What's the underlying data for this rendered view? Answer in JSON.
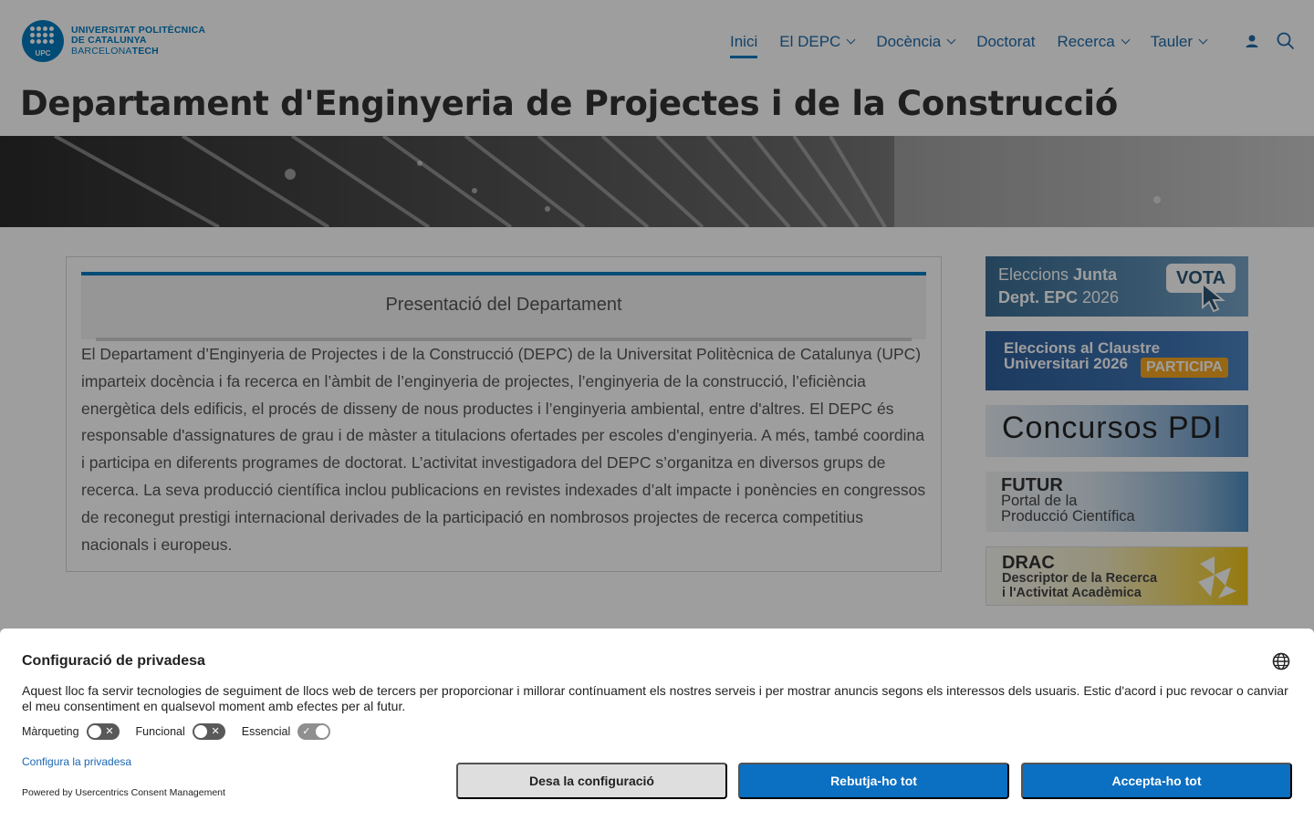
{
  "logo": {
    "line1": "UNIVERSITAT POLITÈCNICA",
    "line2": "DE CATALUNYA",
    "line3a": "BARCELONA",
    "line3b": "TECH",
    "badge": "UPC"
  },
  "nav": {
    "items": [
      {
        "label": "Inici",
        "active": true,
        "dropdown": false
      },
      {
        "label": "El DEPC",
        "active": false,
        "dropdown": true
      },
      {
        "label": "Docència",
        "active": false,
        "dropdown": true
      },
      {
        "label": "Doctorat",
        "active": false,
        "dropdown": false
      },
      {
        "label": "Recerca",
        "active": false,
        "dropdown": true
      },
      {
        "label": "Tauler",
        "active": false,
        "dropdown": true
      }
    ],
    "icons": [
      "user-icon",
      "search-icon"
    ]
  },
  "page_title": {
    "regular": "Departament d'Enginyeria de ",
    "bold": "Projectes i de la Construcció"
  },
  "presentation": {
    "title": "Presentació del Departament",
    "body": "El Departament d’Enginyeria de Projectes i de la Construcció (DEPC) de la Universitat Politècnica de Catalunya (UPC) imparteix docència i fa recerca en l’àmbit de l’enginyeria de projectes, l’enginyeria de la construcció, l’eficiència energètica dels edificis, el procés de disseny de nous productes i l’enginyeria ambiental, entre d'altres. El DEPC és responsable d'assignatures de grau i de màster a titulacions ofertades per escoles d'enginyeria. A més, també coordina i participa en diferents programes de doctorat. L’activitat investigadora del DEPC s’organitza en diversos grups de recerca. La seva producció científica inclou publicacions en revistes indexades d’alt impacte i ponències en congressos de reconegut prestigi internacional derivades de la participació en nombrosos projectes de recerca competitius nacionals i europeus."
  },
  "sidebar": {
    "vota": {
      "line1a": "Eleccions ",
      "line1b": "Junta",
      "line2a": "Dept. EPC ",
      "line2b": "2026",
      "badge": "VOTA"
    },
    "claustre": {
      "line1": "Eleccions al Claustre",
      "line2": "Universitari 2026",
      "badge": "PARTICIPA"
    },
    "concursos": {
      "text": "Concursos  PDI"
    },
    "futur": {
      "title": "FUTUR",
      "line1": "Portal de la",
      "line2": "Producció Científica"
    },
    "drac": {
      "title": "DRAC",
      "line1": "Descriptor de la Recerca",
      "line2": "i l'Activitat Acadèmica"
    }
  },
  "consent": {
    "title": "Configuració de privadesa",
    "text": "Aquest lloc fa servir tecnologies de seguiment de llocs web de tercers per proporcionar i millorar contínuament els nostres serveis i per mostrar anuncis segons els interessos dels usuaris. Estic d'acord i puc revocar o canviar el meu consentiment en qualsevol moment amb efectes per al futur.",
    "toggles": [
      {
        "label": "Màrqueting",
        "checked": false
      },
      {
        "label": "Funcional",
        "checked": false
      },
      {
        "label": "Essencial",
        "checked": true
      }
    ],
    "configure_link": "Configura la privadesa",
    "powered_by": "Powered by Usercentrics Consent Management",
    "buttons": {
      "save": "Desa la configuració",
      "deny": "Rebutja-ho tot",
      "accept": "Accepta-ho tot"
    }
  },
  "colors": {
    "brand": "#007bc0",
    "button_primary": "#0b6fc2",
    "button_secondary": "#dedede",
    "link": "#1a66b3"
  }
}
